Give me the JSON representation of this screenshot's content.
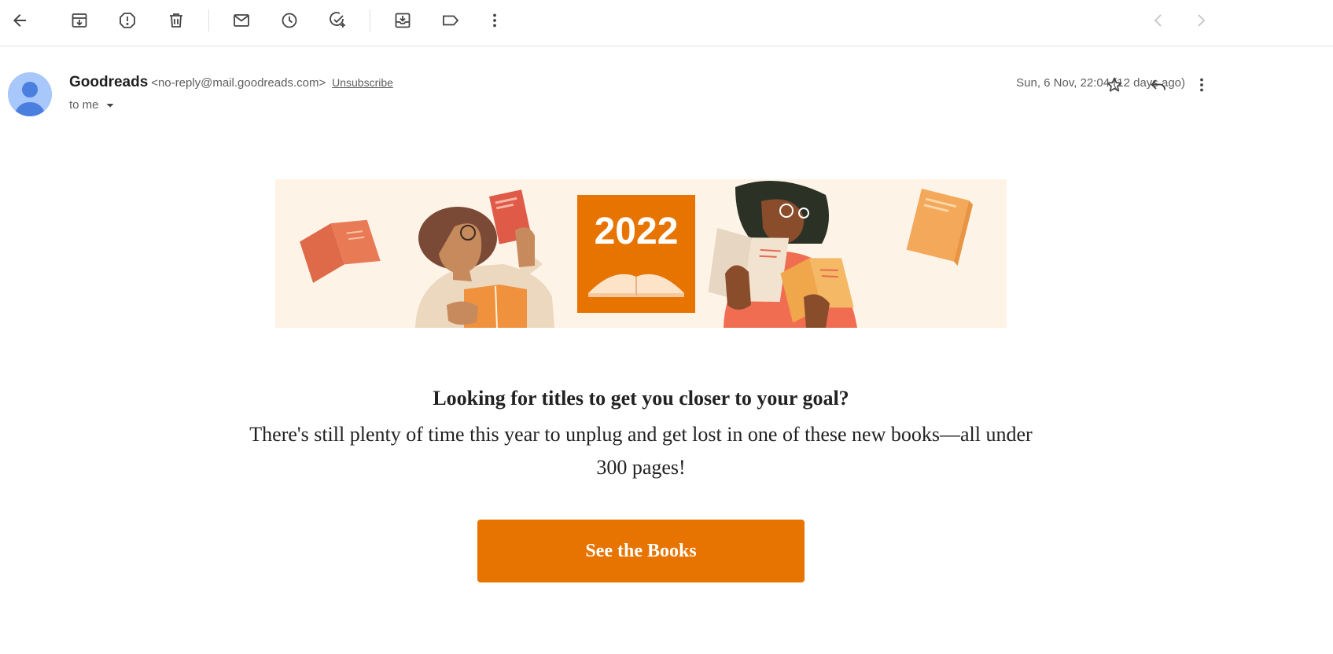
{
  "toolbar": {
    "icons": [
      "back-arrow-icon",
      "archive-icon",
      "report-spam-icon",
      "delete-icon",
      "mark-unread-icon",
      "snooze-icon",
      "add-to-tasks-icon",
      "move-to-icon",
      "label-icon",
      "more-vert-icon",
      "prev-icon",
      "next-icon"
    ]
  },
  "email": {
    "sender_name": "Goodreads",
    "sender_email": "<no-reply@mail.goodreads.com>",
    "unsubscribe": "Unsubscribe",
    "to": "to me",
    "date": "Sun, 6 Nov, 22:04 (12 days ago)"
  },
  "banner": {
    "year": "2022"
  },
  "content": {
    "headline": "Looking for titles to get you closer to your goal?",
    "body": "There's still plenty of time this year to unplug and get lost in one of these new books—all under 300 pages!",
    "cta": "See the Books"
  },
  "colors": {
    "accent": "#e87400",
    "banner_bg": "#fdf4e7"
  }
}
